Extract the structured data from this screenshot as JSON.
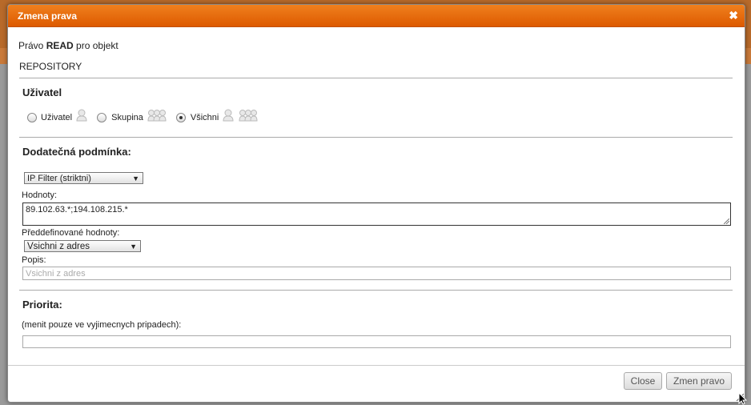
{
  "dialog": {
    "title": "Zmena prava",
    "close_glyph": "✖"
  },
  "intro": {
    "prefix": "Právo ",
    "permission": "READ",
    "suffix": " pro objekt"
  },
  "object_name": "REPOSITORY",
  "user_section": {
    "title": "Uživatel",
    "options": [
      {
        "label": "Uživatel",
        "checked": false,
        "icon": "single-user-icon"
      },
      {
        "label": "Skupina",
        "checked": false,
        "icon": "group-icon"
      },
      {
        "label": "Všichni",
        "checked": true,
        "icon": "everyone-icon"
      }
    ]
  },
  "condition_section": {
    "title": "Dodatečná podmínka:",
    "filter_select": "IP Filter (striktni)",
    "values_label": "Hodnoty:",
    "values_text": "89.102.63.*;194.108.215.*",
    "predefined_label": "Předdefinované hodnoty:",
    "predefined_select": "Vsichni z adres",
    "description_label": "Popis:",
    "description_placeholder": "Vsichni z adres"
  },
  "priority_section": {
    "title": "Priorita:",
    "hint": "(menit pouze ve vyjimecnych pripadech):",
    "value": ""
  },
  "buttons": {
    "close": "Close",
    "submit": "Zmen pravo"
  }
}
